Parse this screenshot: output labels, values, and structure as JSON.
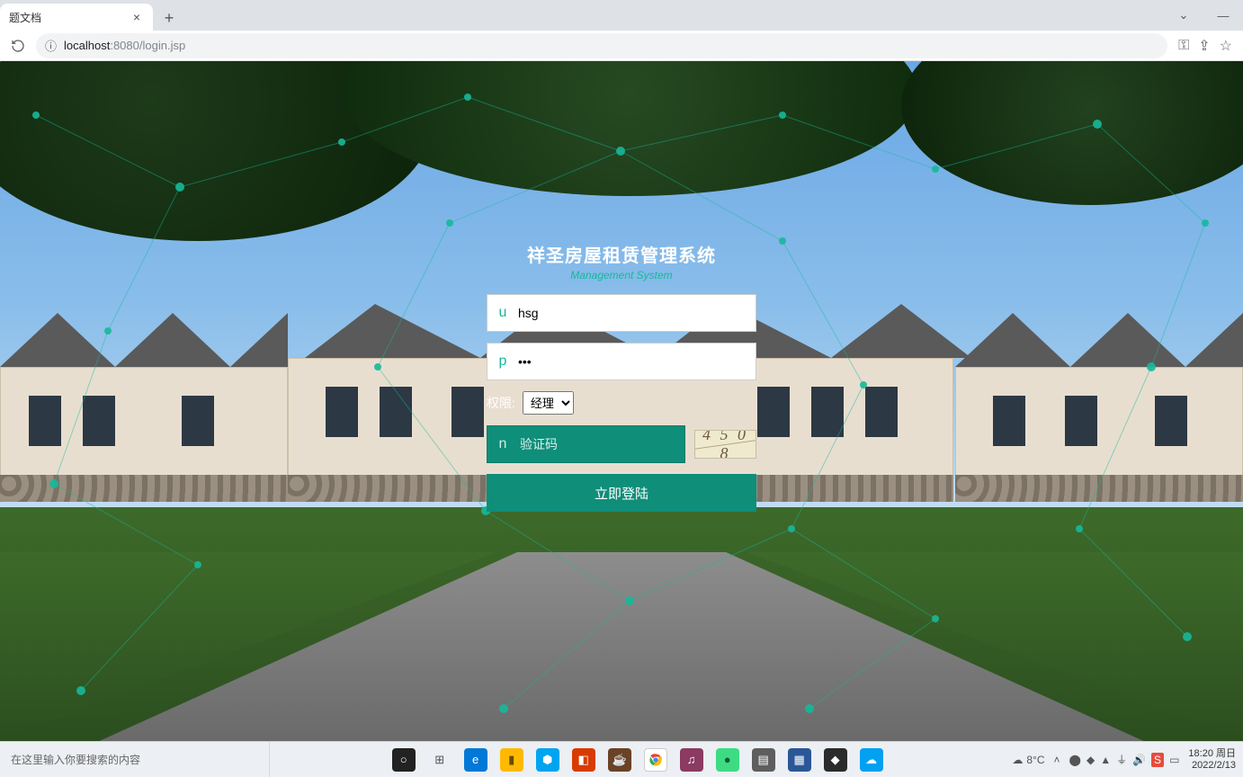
{
  "browser": {
    "tab_title": "题文档",
    "url_info_icon": "ⓘ",
    "url_host": "localhost",
    "url_port": ":8080",
    "url_path": "/login.jsp"
  },
  "login": {
    "title": "祥圣房屋租赁管理系统",
    "subtitle": "Management System",
    "username_icon": "u",
    "username_value": "hsg",
    "password_icon": "p",
    "password_value": "•••",
    "permission_label": "权限:",
    "permission_selected": "经理",
    "captcha_icon": "n",
    "captcha_placeholder": "验证码",
    "captcha_code": "4 5 0 8",
    "login_button": "立即登陆"
  },
  "taskbar": {
    "search_placeholder": "在这里输入你要搜索的内容",
    "weather_temp": "8°C",
    "time": "18:20",
    "day": "周日",
    "date": "2022/2/13"
  }
}
